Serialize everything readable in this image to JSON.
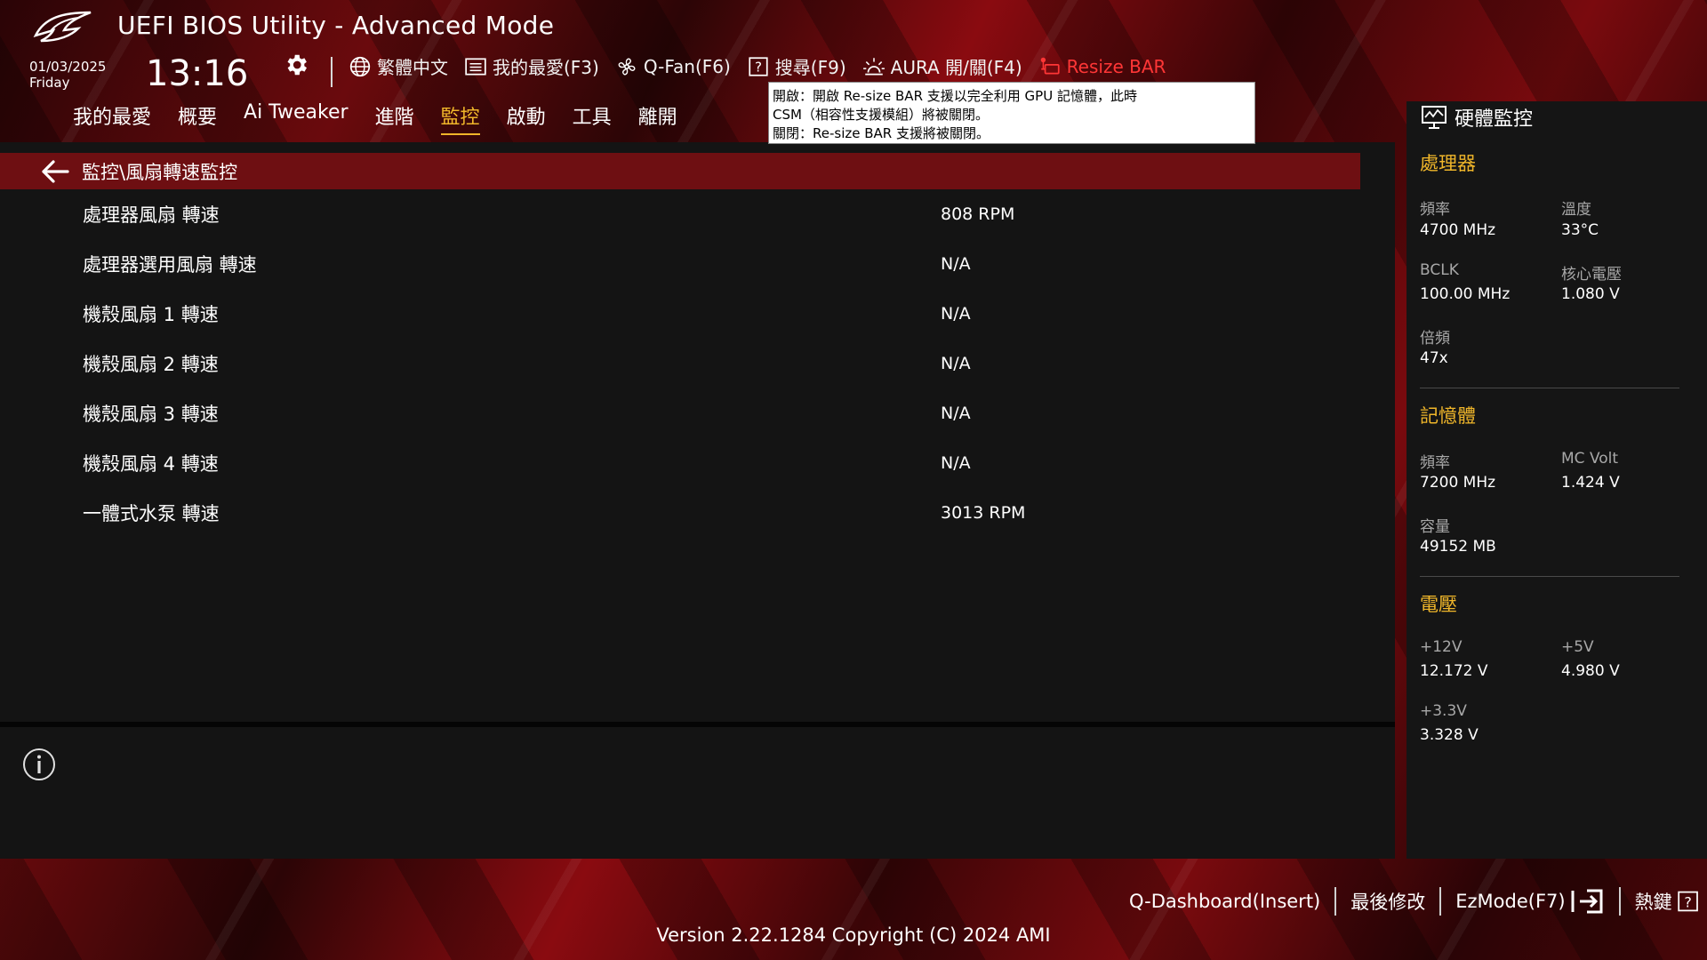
{
  "header": {
    "app_title": "UEFI BIOS Utility - Advanced Mode",
    "date": "01/03/2025",
    "weekday": "Friday",
    "time": "13:16"
  },
  "toolbar": {
    "items": [
      {
        "label": "繁體中文",
        "icon": "globe-icon"
      },
      {
        "label": "我的最愛(F3)",
        "icon": "favorites-list-icon"
      },
      {
        "label": "Q-Fan(F6)",
        "icon": "fan-icon"
      },
      {
        "label": "搜尋(F9)",
        "icon": "question-box-icon"
      },
      {
        "label": "AURA 開/關(F4)",
        "icon": "aura-light-icon"
      },
      {
        "label": "Resize BAR",
        "icon": "resize-bar-icon"
      }
    ]
  },
  "tooltip": {
    "line1": "開啟：開啟 Re-size BAR 支援以完全利用 GPU 記憶體，此時",
    "line2": "CSM（相容性支援模組）將被關閉。",
    "line3": "關閉：Re-size BAR 支援將被關閉。"
  },
  "nav": {
    "tabs": [
      "我的最愛",
      "概要",
      "Ai Tweaker",
      "進階",
      "監控",
      "啟動",
      "工具",
      "離開"
    ],
    "active_index": 4
  },
  "breadcrumb": "監控\\風扇轉速監控",
  "rows": [
    {
      "label": "處理器風扇 轉速",
      "value": "808 RPM"
    },
    {
      "label": "處理器選用風扇 轉速",
      "value": "N/A"
    },
    {
      "label": "機殼風扇 1 轉速",
      "value": "N/A"
    },
    {
      "label": "機殼風扇 2 轉速",
      "value": "N/A"
    },
    {
      "label": "機殼風扇 3 轉速",
      "value": "N/A"
    },
    {
      "label": "機殼風扇 4 轉速",
      "value": "N/A"
    },
    {
      "label": "一體式水泵 轉速",
      "value": "3013 RPM"
    }
  ],
  "hw_monitor": {
    "title": "硬體監控",
    "cpu": {
      "heading": "處理器",
      "freq_label": "頻率",
      "freq_value": "4700 MHz",
      "temp_label": "溫度",
      "temp_value": "33°C",
      "bclk_label": "BCLK",
      "bclk_value": "100.00 MHz",
      "vcore_label": "核心電壓",
      "vcore_value": "1.080 V",
      "ratio_label": "倍頻",
      "ratio_value": "47x"
    },
    "memory": {
      "heading": "記憶體",
      "freq_label": "頻率",
      "freq_value": "7200 MHz",
      "mcvolt_label": "MC Volt",
      "mcvolt_value": "1.424 V",
      "cap_label": "容量",
      "cap_value": "49152 MB"
    },
    "voltage": {
      "heading": "電壓",
      "v12_label": "+12V",
      "v12_value": "12.172 V",
      "v5_label": "+5V",
      "v5_value": "4.980 V",
      "v33_label": "+3.3V",
      "v33_value": "3.328 V"
    }
  },
  "footer": {
    "qdashboard": "Q-Dashboard(Insert)",
    "last_modified": "最後修改",
    "ezmode": "EzMode(F7)",
    "hotkeys": "熱鍵",
    "version": "Version 2.22.1284 Copyright (C) 2024 AMI"
  },
  "colors": {
    "accent_gold": "#f0b62a",
    "active_red": "#ff3636",
    "breadcrumb_bg": "#6e0f12"
  }
}
